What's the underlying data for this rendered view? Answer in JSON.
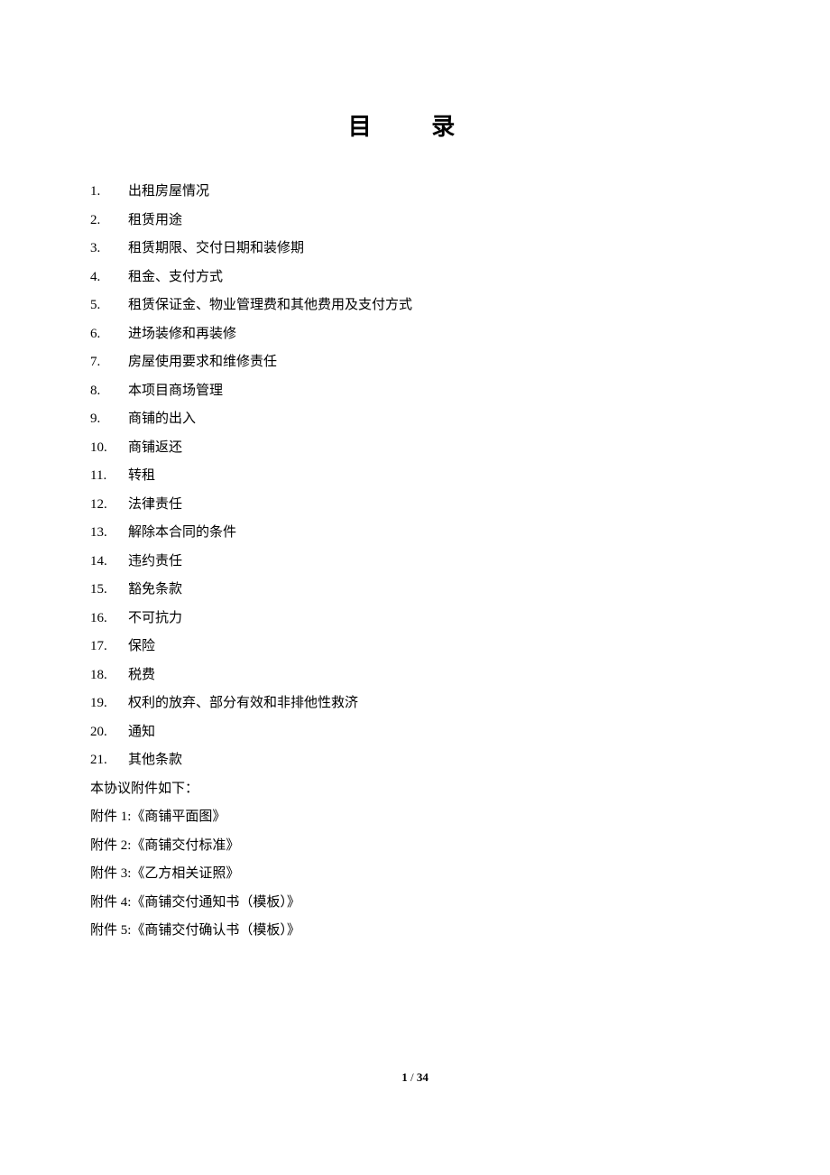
{
  "title": "目  录",
  "toc": [
    {
      "num": "1.",
      "text": "出租房屋情况"
    },
    {
      "num": "2.",
      "text": "租赁用途"
    },
    {
      "num": "3.",
      "text": "租赁期限、交付日期和装修期"
    },
    {
      "num": "4.",
      "text": "租金、支付方式"
    },
    {
      "num": "5.",
      "text": "租赁保证金、物业管理费和其他费用及支付方式"
    },
    {
      "num": "6.",
      "text": "进场装修和再装修"
    },
    {
      "num": "7.",
      "text": "房屋使用要求和维修责任"
    },
    {
      "num": "8.",
      "text": "本项目商场管理"
    },
    {
      "num": "9.",
      "text": "商铺的出入"
    },
    {
      "num": "10.",
      "text": "商铺返还"
    },
    {
      "num": "11.",
      "text": "转租"
    },
    {
      "num": "12.",
      "text": "法律责任"
    },
    {
      "num": "13.",
      "text": "解除本合同的条件"
    },
    {
      "num": "14.",
      "text": "违约责任"
    },
    {
      "num": "15.",
      "text": "豁免条款"
    },
    {
      "num": "16.",
      "text": "不可抗力"
    },
    {
      "num": "17.",
      "text": "保险"
    },
    {
      "num": "18.",
      "text": "税费"
    },
    {
      "num": "19.",
      "text": "权利的放弃、部分有效和非排他性救济"
    },
    {
      "num": "20.",
      "text": "通知"
    },
    {
      "num": "21.",
      "text": "其他条款"
    }
  ],
  "appendixHeader": "本协议附件如下：",
  "appendices": [
    "附件 1:《商铺平面图》",
    "附件 2:《商铺交付标准》",
    "附件 3:《乙方相关证照》",
    "附件 4:《商铺交付通知书（模板）》",
    "附件 5:《商铺交付确认书（模板）》"
  ],
  "footer": {
    "current": "1",
    "separator": " / ",
    "total": "34"
  }
}
